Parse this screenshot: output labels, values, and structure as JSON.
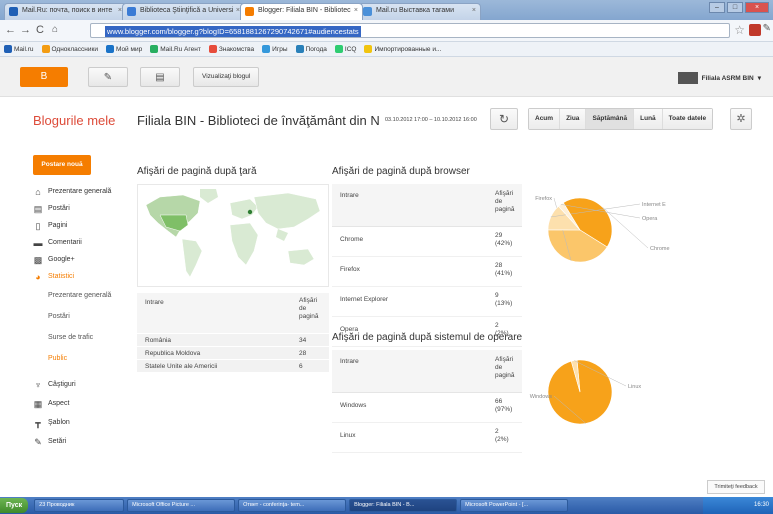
{
  "browser": {
    "tabs": [
      {
        "title": "Mail.Ru: почта, поиск в инте",
        "color": "#1f5fb5"
      },
      {
        "title": "Biblioteca Ştiinţifică a Universi",
        "color": "#3a7bd5"
      },
      {
        "title": "Blogger: Filiala BIN - Bibliotec",
        "color": "#f57d00"
      },
      {
        "title": "Mail.ru Выставка тагами",
        "color": "#4a90d9"
      }
    ],
    "url": "www.blogger.com/blogger.g?blogID=6581881267290742671#audiencestats",
    "bookmarks": [
      {
        "label": "Mail.ru",
        "color": "#1f5fb5"
      },
      {
        "label": "Одноклассники",
        "color": "#f39c12"
      },
      {
        "label": "Мой мир",
        "color": "#1a73c8"
      },
      {
        "label": "Mail.Ru Агент",
        "color": "#27ae60"
      },
      {
        "label": "Знакомства",
        "color": "#e74c3c"
      },
      {
        "label": "Игры",
        "color": "#3498db"
      },
      {
        "label": "Погода",
        "color": "#2980b9"
      },
      {
        "label": "ICQ",
        "color": "#2ecc71"
      },
      {
        "label": "Импортированные и...",
        "color": "#f1c40f"
      }
    ]
  },
  "header": {
    "view_blog": "Vizualizaţi blogul",
    "user": "Filiala ASRM BIN"
  },
  "brand": "Blogurile mele",
  "blog_title": "Filiala BIN - Biblioteci de învăţământ din N",
  "date_range": "03.10.2012 17:00 – 10.10.2012 16:00",
  "periods": [
    "Acum",
    "Ziua",
    "Săptămână",
    "Lună",
    "Toate datele"
  ],
  "new_post": "Postare nouă",
  "sidebar": [
    {
      "label": "Prezentare generală",
      "icon": "home-icon",
      "glyph": "⌂"
    },
    {
      "label": "Postări",
      "icon": "posts-icon",
      "glyph": "▤"
    },
    {
      "label": "Pagini",
      "icon": "pages-icon",
      "glyph": "▯"
    },
    {
      "label": "Comentarii",
      "icon": "comments-icon",
      "glyph": "▬"
    },
    {
      "label": "Google+",
      "icon": "google-plus-icon",
      "glyph": "▩"
    },
    {
      "label": "Statistici",
      "icon": "stats-icon",
      "glyph": "◕"
    }
  ],
  "sidebar_sub": [
    "Prezentare generală",
    "Postări",
    "Surse de trafic",
    "Public"
  ],
  "sidebar_bottom": [
    {
      "label": "Câştiguri",
      "icon": "earnings-icon",
      "glyph": "♆"
    },
    {
      "label": "Aspect",
      "icon": "layout-icon",
      "glyph": "▦"
    },
    {
      "label": "Şablon",
      "icon": "template-icon",
      "glyph": "┳"
    },
    {
      "label": "Setări",
      "icon": "settings-icon",
      "glyph": "✎"
    }
  ],
  "country": {
    "heading": "Afişări de pagină după ţară",
    "col_entry": "Intrare",
    "col_views": "Afişări de pagină",
    "rows": [
      {
        "name": "România",
        "views": "34"
      },
      {
        "name": "Republica Moldova",
        "views": "28"
      },
      {
        "name": "Statele Unite ale Americii",
        "views": "6"
      }
    ]
  },
  "browser_stats": {
    "heading": "Afişări de pagină după browser",
    "col_entry": "Intrare",
    "col_views": "Afişări de pagină",
    "rows": [
      {
        "name": "Chrome",
        "views": "29",
        "pct": "(42%)"
      },
      {
        "name": "Firefox",
        "views": "28",
        "pct": "(41%)"
      },
      {
        "name": "Internet Explorer",
        "views": "9",
        "pct": "(13%)"
      },
      {
        "name": "Opera",
        "views": "2",
        "pct": "(2%)"
      }
    ]
  },
  "os_stats": {
    "heading": "Afişări de pagină după sistemul de operare",
    "col_entry": "Intrare",
    "col_views": "Afişări de pagină",
    "rows": [
      {
        "name": "Windows",
        "views": "66",
        "pct": "(97%)"
      },
      {
        "name": "Linux",
        "views": "2",
        "pct": "(2%)"
      }
    ]
  },
  "chart_data": [
    {
      "type": "pie",
      "categories": [
        "Chrome",
        "Firefox",
        "Internet E",
        "Opera"
      ],
      "values": [
        29,
        28,
        9,
        2
      ],
      "colors": [
        "#f7a21a",
        "#fbc66a",
        "#fde0ad",
        "#fef0d8"
      ]
    },
    {
      "type": "pie",
      "categories": [
        "Windows",
        "Linux"
      ],
      "values": [
        66,
        2
      ],
      "colors": [
        "#f7a21a",
        "#fde0ad"
      ]
    }
  ],
  "feedback": "Trimiteţi feedback",
  "taskbar": {
    "start": "Пуск",
    "items": [
      {
        "label": "23 Проводник",
        "active": false
      },
      {
        "label": "Microsoft Office Picture ...",
        "active": false
      },
      {
        "label": "Ответ - conferinţa- tem...",
        "active": false
      },
      {
        "label": "Blogger: Filiala BIN - B...",
        "active": true
      },
      {
        "label": "Microsoft PowerPoint - [...",
        "active": false
      }
    ],
    "clock": "16:30"
  }
}
